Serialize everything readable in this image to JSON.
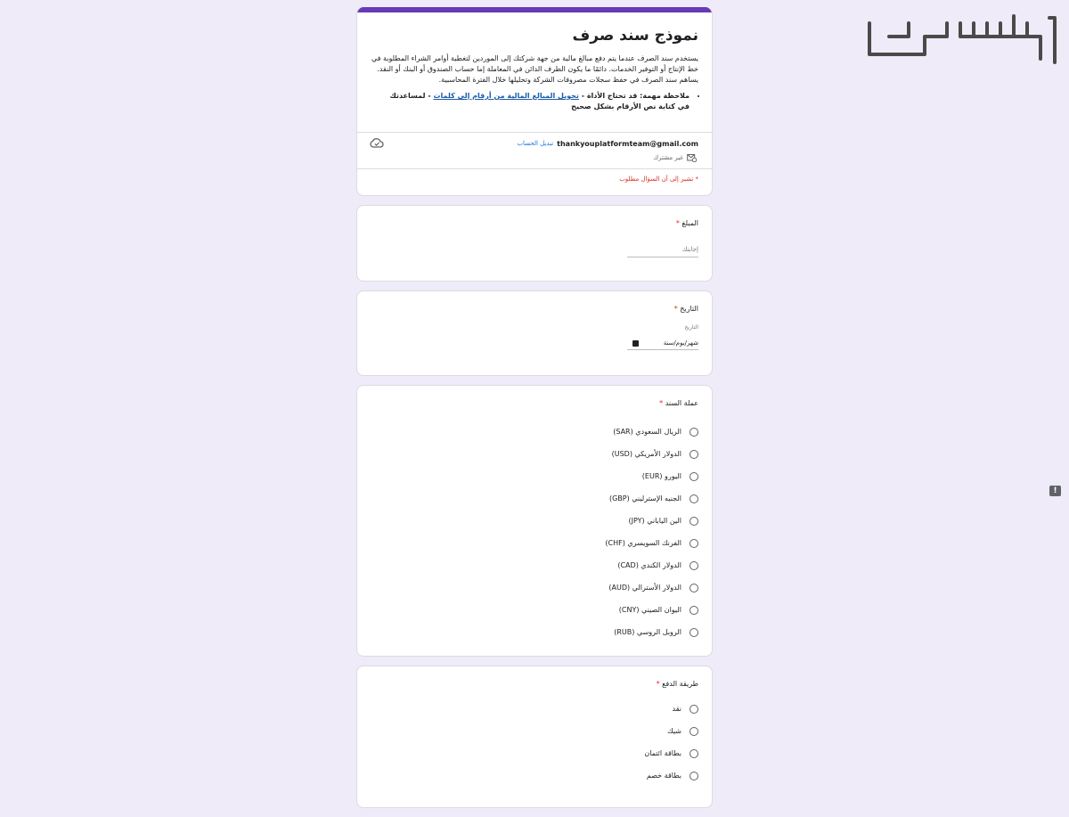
{
  "brand": {
    "logo_text": "مستعمل"
  },
  "form": {
    "title": "نموذج سند صرف",
    "description": "يستخدم سند الصرف عندما يتم دفع مبالغ مالية من جهة شركتك إلى الموردين لتغطية أوامر الشراء المطلوبة في خط الإنتاج أو التوفير الخدمات. دائمًا ما يكون الطرف الدائن في المعاملة إما حساب الصندوق أو البنك أو النقد. يساهم سند الصرف في حفظ سجلات مصروفات الشركة وتحليلها خلال الفترة المحاسبية.",
    "note_prefix": "ملاحظة مهمة: قد تحتاج الأداة - ",
    "note_link": "تحويل المبالغ المالية من أرقام إلى كلمات",
    "note_suffix": " - لمساعدتك في كتابة نص الأرقام بشكل صحيح",
    "account_email": "thankyouplatformteam@gmail.com",
    "switch_account": "تبديل الحساب",
    "not_shared": "غير مشترك",
    "required_note": "* تشير إلى أن السؤال مطلوب"
  },
  "questions": {
    "amount": {
      "label": "المبلغ",
      "placeholder": "إجابتك"
    },
    "date": {
      "label": "التاريخ",
      "sublabel": "التاريخ",
      "value": "شهر/يوم/سنة"
    },
    "currency": {
      "label": "عملة السند",
      "options": [
        "الريال السعودي (SAR)",
        "الدولار الأمريكي (USD)",
        "اليورو (EUR)",
        "الجنيه الإسترليني (GBP)",
        "الين الياباني (JPY)",
        "الفرنك السويسري (CHF)",
        "الدولار الكندي (CAD)",
        "الدولار الأسترالي (AUD)",
        "اليوان الصيني (CNY)",
        "الروبل الروسي (RUB)"
      ]
    },
    "payment": {
      "label": "طريقة الدفع",
      "options": [
        "نقد",
        "شيك",
        "بطاقة ائتمان",
        "بطاقة خصم"
      ]
    }
  },
  "required_mark": "*",
  "colors": {
    "accent": "#673ab7",
    "background": "#efebf8",
    "required": "#d93025",
    "link": "#1a73e8"
  }
}
